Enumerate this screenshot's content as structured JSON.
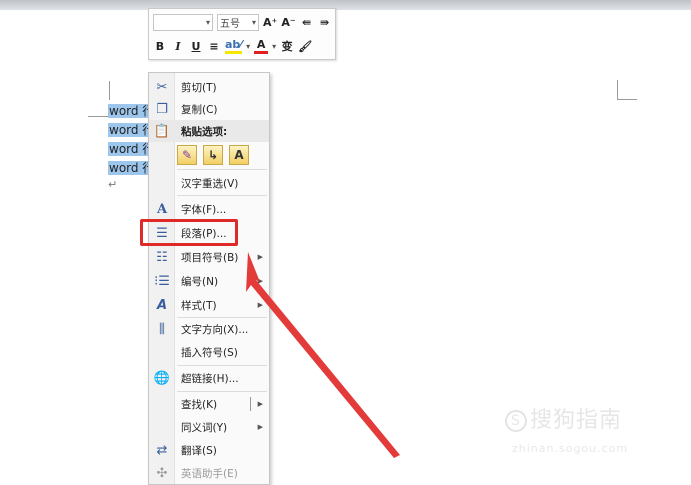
{
  "mini_toolbar": {
    "font_value": "",
    "size_value": "五号",
    "row1_buttons": [
      "A⁺",
      "A⁻",
      "⇚",
      "⇛"
    ],
    "bold": "B",
    "italic": "I",
    "underline": "U",
    "center": "≡",
    "highlight": "ab⁄",
    "font_color": "A",
    "phonetic": "变",
    "format_painter": "🖌"
  },
  "document": {
    "lines": [
      "word 行",
      "word 行",
      "word 行",
      "word 行"
    ],
    "paragraph_mark": "↵"
  },
  "context_menu": {
    "cut": "剪切(T)",
    "copy": "复制(C)",
    "paste_options_header": "粘贴选项:",
    "paste_buttons": [
      "✎",
      "↳",
      "A"
    ],
    "hanzi_reselect": "汉字重选(V)",
    "font": "字体(F)...",
    "paragraph": "段落(P)...",
    "bullets": "项目符号(B)",
    "numbering": "编号(N)",
    "styles": "样式(T)",
    "text_direction": "文字方向(X)...",
    "insert_symbol": "插入符号(S)",
    "hyperlink": "超链接(H)...",
    "lookup": "查找(K)",
    "synonyms": "同义词(Y)",
    "translate": "翻译(S)",
    "english_assistant": "英语助手(E)"
  },
  "watermark": {
    "text": "搜狗指南",
    "sub": "zhinan.sogou.com",
    "logo_letter": "S"
  },
  "colors": {
    "selection": "#9dc6ec",
    "callout_red": "#e02a2a"
  }
}
